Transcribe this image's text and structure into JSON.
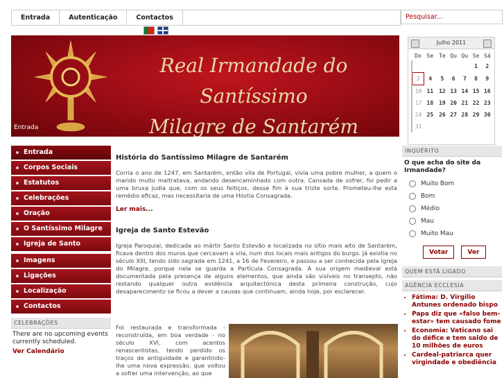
{
  "nav": {
    "tabs": [
      "Entrada",
      "Autenticação",
      "Contactos"
    ]
  },
  "search": {
    "placeholder": "Pesquisar..."
  },
  "banner": {
    "title_line1": "Real Irmandade do Santíssimo",
    "title_line2": "Milagre de Santarém",
    "breadcrumb": "Entrada"
  },
  "calendar": {
    "month": "Julho 2011",
    "weekdays": [
      "Do",
      "Se",
      "Te",
      "Qu",
      "Qu",
      "Se",
      "Sá"
    ],
    "weeks": [
      {
        "wk": "",
        "days": [
          "",
          "",
          "",
          "",
          "",
          "1",
          "2"
        ]
      },
      {
        "wk": "",
        "days": [
          "3",
          "4",
          "5",
          "6",
          "7",
          "8",
          "9"
        ]
      },
      {
        "wk": "",
        "days": [
          "10",
          "11",
          "12",
          "13",
          "14",
          "15",
          "16"
        ]
      },
      {
        "wk": "",
        "days": [
          "17",
          "18",
          "19",
          "20",
          "21",
          "22",
          "23"
        ]
      },
      {
        "wk": "",
        "days": [
          "24",
          "25",
          "26",
          "27",
          "28",
          "29",
          "30"
        ]
      },
      {
        "wk": "",
        "days": [
          "31",
          "",
          "",
          "",
          "",
          "",
          ""
        ]
      }
    ],
    "today": "3"
  },
  "menu": {
    "items": [
      "Entrada",
      "Corpos Sociais",
      "Estatutos",
      "Celebrações",
      "Oração",
      "O Santíssimo Milagre",
      "Igreja de Santo Estevão",
      "Imagens",
      "Ligações",
      "Localização",
      "Contactos"
    ]
  },
  "celebracoes": {
    "heading": "CELEBRAÇÕES",
    "text": "There are no upcoming events currently scheduled.",
    "link": "Ver Calendário"
  },
  "article1": {
    "title": "História do Santíssimo Milagre de Santarém",
    "body": "Corria o ano de 1247, em Santarém, então vila de Portugal, vivia uma pobre mulher, a quem o marido muito maltratava, andando desencaminhado com outra. Cansada de sofrer, foi pedir a uma bruxa judia que, com os seus feitiços, desse fim à sua triste sorte. Prometeu-lhe esta remédio eficaz, mas necessitaria de uma Hóstia Consagrada.",
    "more": "Ler mais..."
  },
  "article2": {
    "title": "Igreja de Santo Estevão",
    "body": "Igreja Paroquial, dedicada ao mártir Santo Estevão e localizada no sítio mais alto de Santarém, ficava dentro dos muros que cercavam a vila, num dos locais mais antigos do burgo. Já existia no século XIII, tendo sido sagrada em 1241, a 16 de Fevereiro, e passou a ser conhecida pela Igreja do Milagre, porque nela se guarda a Partícula Consagrada. A sua origem medieval está documentada pela presença de alguns elementos, que ainda são visíveis no transepto, não restando qualquer outra evidência arquitectónica desta primeira construção, cujo desaparecimento se ficou a dever a causas que continuam, ainda hoje, por esclarecer.",
    "lower": "Foi restaurada e transformada - reconstruída, em boa verdade - no século XVI, com acentos renascentistas, tendo perdido os traços de antiguidade e garantindo-lhe uma nova expressão, que voltou a sofrer uma intervenção, ao que"
  },
  "poll": {
    "heading": "INQUÉRITO",
    "question": "O que acha do site da Irmandade?",
    "options": [
      "Muito Bom",
      "Bom",
      "Médio",
      "Mau",
      "Muito Mau"
    ],
    "vote": "Votar",
    "results": "Ver"
  },
  "online": {
    "heading": "QUEM ESTÁ LIGADO"
  },
  "ecclesia": {
    "heading": "AGÊNCIA ECCLESIA",
    "items": [
      "Fátima: D. Virgílio Antunes ordenado bispo",
      "Papa diz que «falso bem-estar» tem causado fome",
      "Economia: Vaticano sai do défice e tem saldo de 10 milhões de euros",
      "Cardeal-patriarca quer virgindade e obediência"
    ]
  },
  "colors": {
    "accent": "#8b0000",
    "menu": "#a4141c"
  }
}
